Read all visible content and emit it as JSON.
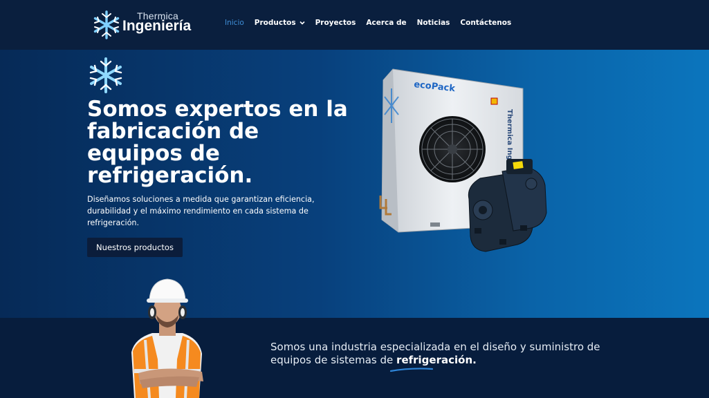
{
  "brand": {
    "name_top": "Thermica",
    "name_main": "Ingeniería"
  },
  "nav": {
    "items": [
      {
        "label": "Inicio",
        "active": true
      },
      {
        "label": "Productos",
        "has_dropdown": true
      },
      {
        "label": "Proyectos"
      },
      {
        "label": "Acerca de"
      },
      {
        "label": "Noticias"
      },
      {
        "label": "Contáctenos"
      }
    ]
  },
  "hero": {
    "title_lines": [
      "Somos expertos en la",
      "fabricación de",
      "equipos de",
      "refrigeración."
    ],
    "description": "Diseñamos soluciones a medida que garantizan eficiencia, durabilidad y el máximo rendimiento en cada sistema de refrigeración.",
    "button_label": "Nuestros productos",
    "product": {
      "brand_label": "ecoPack",
      "side_label": "Thermica Ingeniería"
    }
  },
  "band": {
    "line1": "Somos una industria especializada en el diseño y suministro de",
    "line2_prefix": "equipos de sistemas de ",
    "line2_strong": "refrigeración."
  },
  "colors": {
    "header_bg": "#0a1f3e",
    "nav_active": "#3f8fd8",
    "hero_left": "#062a57",
    "hero_right": "#0b75bd",
    "band_bg": "#071d3d",
    "button_bg": "#0b1d3b"
  },
  "icons": {
    "logo": "snowflake-logo-icon",
    "hero_mark": "snowflake-icon",
    "dropdown": "chevron-down-icon"
  }
}
